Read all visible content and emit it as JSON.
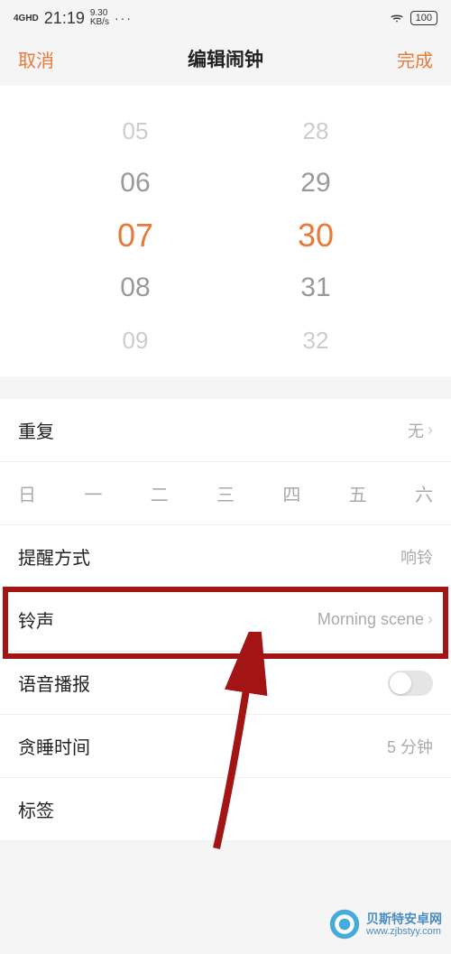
{
  "status": {
    "network": "4GHD",
    "time": "21:19",
    "speed_val": "9.30",
    "speed_unit": "KB/s",
    "dots": "···",
    "battery": "100"
  },
  "nav": {
    "cancel": "取消",
    "title": "编辑闹钟",
    "done": "完成"
  },
  "picker": {
    "hours": [
      "05",
      "06",
      "07",
      "08",
      "09"
    ],
    "minutes": [
      "28",
      "29",
      "30",
      "31",
      "32"
    ]
  },
  "settings": {
    "repeat": {
      "label": "重复",
      "value": "无"
    },
    "days": [
      "日",
      "一",
      "二",
      "三",
      "四",
      "五",
      "六"
    ],
    "remind": {
      "label": "提醒方式",
      "value": "响铃"
    },
    "ringtone": {
      "label": "铃声",
      "value": "Morning scene"
    },
    "voice": {
      "label": "语音播报"
    },
    "snooze": {
      "label": "贪睡时间",
      "value": "5 分钟"
    },
    "tag": {
      "label": "标签"
    }
  },
  "watermark": {
    "name": "贝斯特安卓网",
    "url": "www.zjbstyy.com"
  }
}
